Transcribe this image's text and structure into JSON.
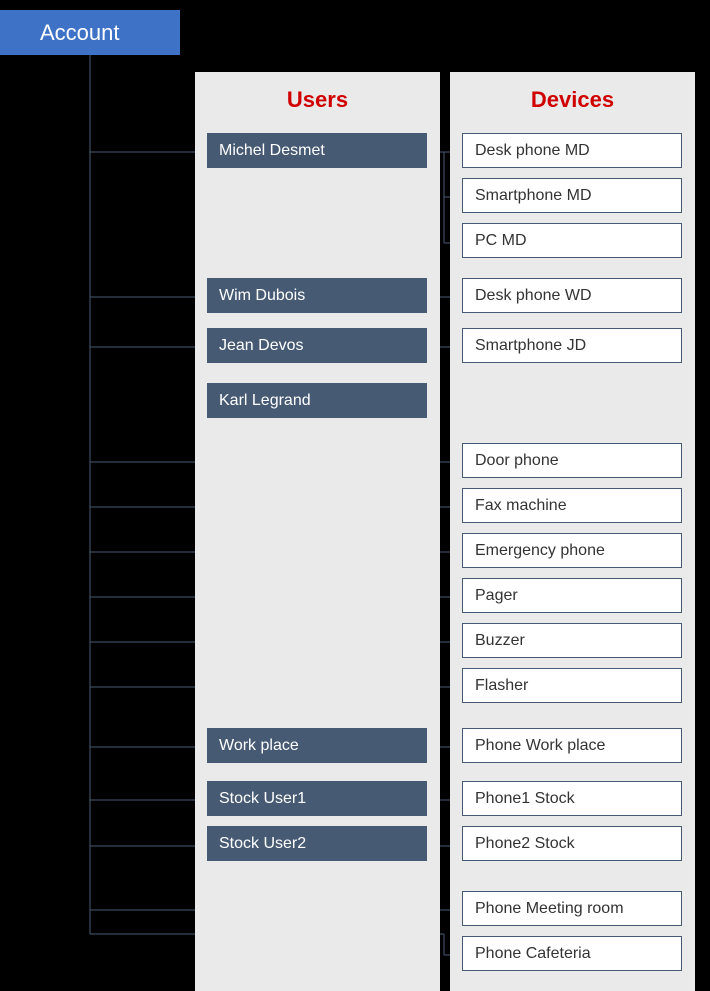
{
  "account": {
    "label": "Account"
  },
  "columns": {
    "users": {
      "header": "Users"
    },
    "devices": {
      "header": "Devices"
    }
  },
  "users": {
    "u1": "Michel Desmet",
    "u2": "Wim Dubois",
    "u3": "Jean Devos",
    "u4": "Karl Legrand",
    "u5": "Work place",
    "u6": "Stock User1",
    "u7": "Stock User2"
  },
  "devices": {
    "d1": "Desk phone MD",
    "d2": "Smartphone MD",
    "d3": "PC MD",
    "d4": "Desk phone WD",
    "d5": "Smartphone JD",
    "d6": "Door phone",
    "d7": "Fax machine",
    "d8": "Emergency phone",
    "d9": "Pager",
    "d10": "Buzzer",
    "d11": "Flasher",
    "d12": "Phone Work place",
    "d13": "Phone1 Stock",
    "d14": "Phone2 Stock",
    "d15": "Phone Meeting room",
    "d16": "Phone Cafeteria"
  }
}
